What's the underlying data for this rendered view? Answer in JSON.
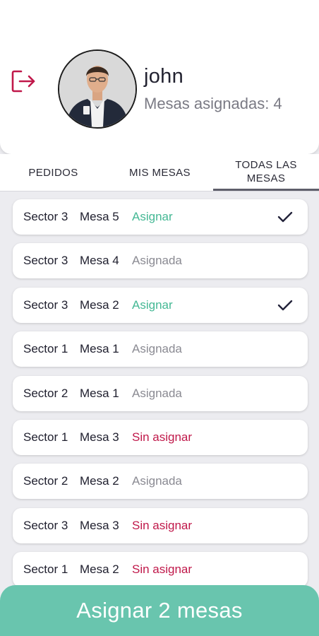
{
  "profile": {
    "name": "john",
    "assigned_text": "Mesas asignadas: 4"
  },
  "tabs": [
    {
      "label": "PEDIDOS"
    },
    {
      "label": "MIS MESAS"
    },
    {
      "label": "TODAS LAS MESAS",
      "selected": true
    }
  ],
  "tables": [
    {
      "sector": "Sector 3",
      "mesa": "Mesa 5",
      "status": "Asignar",
      "checked": true
    },
    {
      "sector": "Sector 3",
      "mesa": "Mesa 4",
      "status": "Asignada",
      "checked": false
    },
    {
      "sector": "Sector 3",
      "mesa": "Mesa 2",
      "status": "Asignar",
      "checked": true
    },
    {
      "sector": "Sector 1",
      "mesa": "Mesa 1",
      "status": "Asignada",
      "checked": false
    },
    {
      "sector": "Sector 2",
      "mesa": "Mesa 1",
      "status": "Asignada",
      "checked": false
    },
    {
      "sector": "Sector 1",
      "mesa": "Mesa 3",
      "status": "Sin asignar",
      "checked": false
    },
    {
      "sector": "Sector 2",
      "mesa": "Mesa 2",
      "status": "Asignada",
      "checked": false
    },
    {
      "sector": "Sector 3",
      "mesa": "Mesa 3",
      "status": "Sin asignar",
      "checked": false
    },
    {
      "sector": "Sector 1",
      "mesa": "Mesa 2",
      "status": "Sin asignar",
      "checked": false
    }
  ],
  "cta": {
    "label": "Asignar 2 mesas"
  },
  "colors": {
    "accent_green": "#69c5ae",
    "asignar_text": "#44b894",
    "sin_asignar_text": "#c0184a",
    "logout_icon": "#c0184a"
  },
  "icons": {
    "logout": "logout-icon",
    "check": "check-icon",
    "avatar": "user-avatar"
  }
}
